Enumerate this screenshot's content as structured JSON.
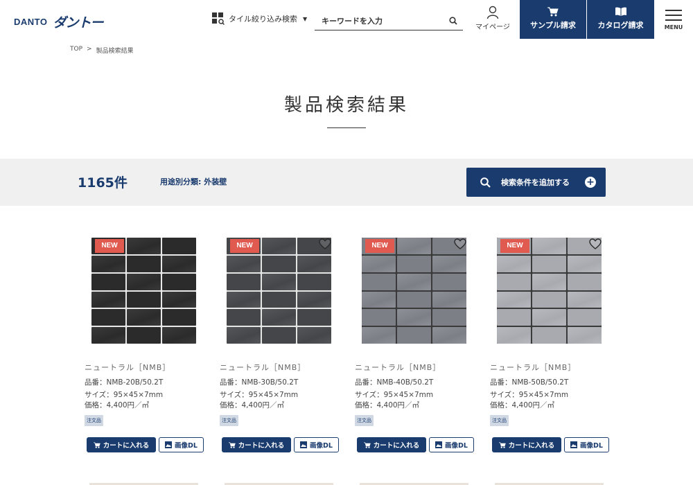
{
  "header": {
    "logo_en": "DANTO",
    "logo_ja": "ダントー",
    "filter_label": "タイル絞り込み検索",
    "search_placeholder": "キーワードを入力",
    "mypage_label": "マイページ",
    "sample_label": "サンプル請求",
    "catalog_label": "カタログ請求",
    "menu_label": "MENU"
  },
  "breadcrumb": {
    "home": "TOP",
    "sep": ">",
    "current": "製品検索結果"
  },
  "page_title": "製品検索結果",
  "results": {
    "count": "1165件",
    "category": "用途別分類: 外装壁",
    "add_condition": "検索条件を追加する"
  },
  "products": [
    {
      "badge": "NEW",
      "series": "ニュートラル［NMB］",
      "part_no": "品番：NMB-20B/50.2T",
      "size": "サイズ：95×45×7mm",
      "price": "価格：4,400円／㎡",
      "tag": "注文品",
      "cart": "カートに入れる",
      "dl": "画像DL",
      "tile_color": "#2b2b2b",
      "tile_color_2": "#3a3a3a",
      "gap_color": "#e8e8e8",
      "favorite": false
    },
    {
      "badge": "NEW",
      "series": "ニュートラル［NMB］",
      "part_no": "品番：NMB-30B/50.2T",
      "size": "サイズ：95×45×7mm",
      "price": "価格：4,400円／㎡",
      "tag": "注文品",
      "cart": "カートに入れる",
      "dl": "画像DL",
      "tile_color": "#45464a",
      "tile_color_2": "#55565a",
      "gap_color": "#e5e5e5",
      "favorite": true
    },
    {
      "badge": "NEW",
      "series": "ニュートラル［NMB］",
      "part_no": "品番：NMB-40B/50.2T",
      "size": "サイズ：95×45×7mm",
      "price": "価格：4,400円／㎡",
      "tag": "注文品",
      "cart": "カートに入れる",
      "dl": "画像DL",
      "tile_color": "#7d7f86",
      "tile_color_2": "#8e9097",
      "gap_color": "#3a3a3a",
      "favorite": true
    },
    {
      "badge": "NEW",
      "series": "ニュートラル［NMB］",
      "part_no": "品番：NMB-50B/50.2T",
      "size": "サイズ：95×45×7mm",
      "price": "価格：4,400円／㎡",
      "tag": "注文品",
      "cart": "カートに入れる",
      "dl": "画像DL",
      "tile_color": "#a9aaaf",
      "tile_color_2": "#b8b9be",
      "gap_color": "#3a3a3a",
      "favorite": true
    }
  ],
  "colors": {
    "brand": "#1a3b6e",
    "badge": "#e05a4f",
    "band": "#f0f0f0"
  }
}
